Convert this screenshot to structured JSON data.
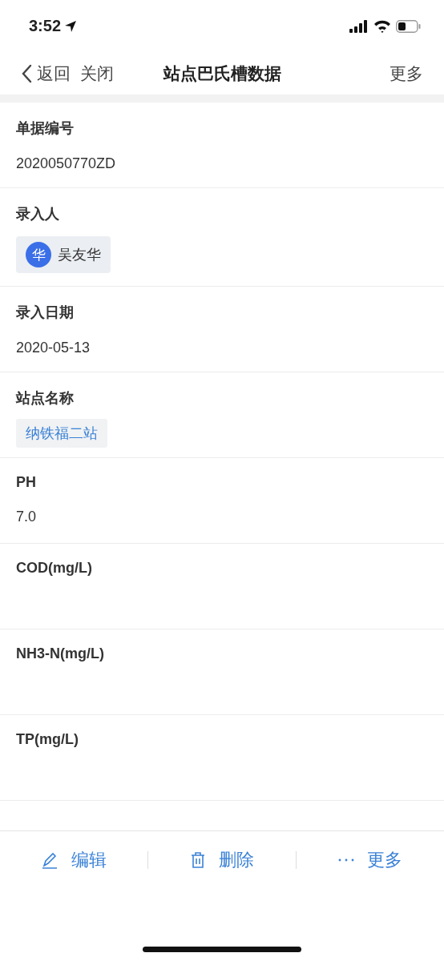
{
  "status_bar": {
    "time": "3:52"
  },
  "nav": {
    "back": "返回",
    "close": "关闭",
    "title": "站点巴氏槽数据",
    "more": "更多"
  },
  "fields": [
    {
      "kind": "text",
      "label": "单据编号",
      "value": "2020050770ZD"
    },
    {
      "kind": "person",
      "label": "录入人",
      "avatar": "华",
      "value": "吴友华"
    },
    {
      "kind": "text",
      "label": "录入日期",
      "value": "2020-05-13"
    },
    {
      "kind": "tag",
      "label": "站点名称",
      "value": "纳铁福二站"
    },
    {
      "kind": "text",
      "label": "PH",
      "value": "7.0"
    },
    {
      "kind": "empty",
      "label": "COD(mg/L)"
    },
    {
      "kind": "empty",
      "label": "NH3-N(mg/L)"
    },
    {
      "kind": "empty",
      "label": "TP(mg/L)"
    }
  ],
  "toolbar": [
    {
      "kind": "edit",
      "label": "编辑"
    },
    {
      "kind": "delete",
      "label": "删除"
    },
    {
      "kind": "more",
      "label": "更多"
    }
  ]
}
